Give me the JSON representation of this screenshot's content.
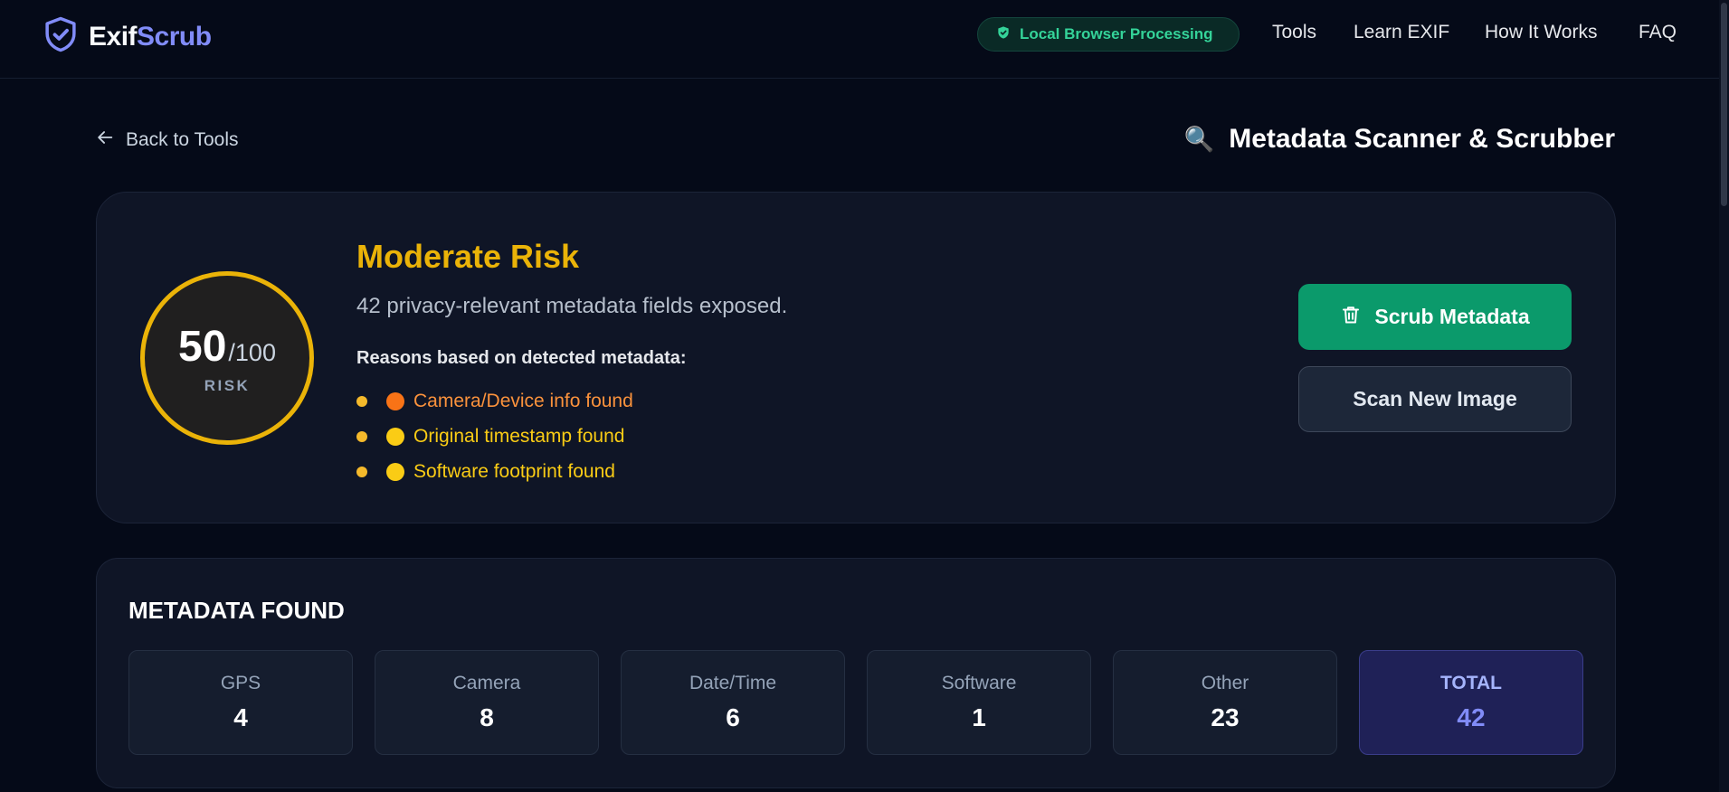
{
  "header": {
    "brand_prefix": "Exif",
    "brand_suffix": "Scrub",
    "badge": "Local Browser Processing",
    "nav": [
      "Tools",
      "Learn EXIF",
      "How It Works",
      "FAQ"
    ]
  },
  "subheader": {
    "back_label": "Back to Tools",
    "title_icon": "🔍",
    "title": "Metadata Scanner & Scrubber"
  },
  "risk": {
    "score": "50",
    "max": "/100",
    "label": "RISK",
    "level": "Moderate Risk",
    "level_color": "#eab308",
    "summary": "42 privacy-relevant metadata fields exposed.",
    "reasons_heading": "Reasons based on detected metadata:",
    "reasons": [
      {
        "text": "Camera/Device info found",
        "severity_color": "#f97316",
        "text_color": "#fb923c"
      },
      {
        "text": "Original timestamp found",
        "severity_color": "#facc15",
        "text_color": "#facc15"
      },
      {
        "text": "Software footprint found",
        "severity_color": "#facc15",
        "text_color": "#facc15"
      }
    ],
    "scrub_label": "Scrub Metadata",
    "scan_label": "Scan New Image"
  },
  "metadata": {
    "heading": "METADATA FOUND",
    "tiles": [
      {
        "label": "GPS",
        "value": "4"
      },
      {
        "label": "Camera",
        "value": "8"
      },
      {
        "label": "Date/Time",
        "value": "6"
      },
      {
        "label": "Software",
        "value": "1"
      },
      {
        "label": "Other",
        "value": "23"
      },
      {
        "label": "TOTAL",
        "value": "42"
      }
    ]
  },
  "colors": {
    "background": "#050a18",
    "accent": "#818cf8",
    "success": "#0b9a6b"
  }
}
